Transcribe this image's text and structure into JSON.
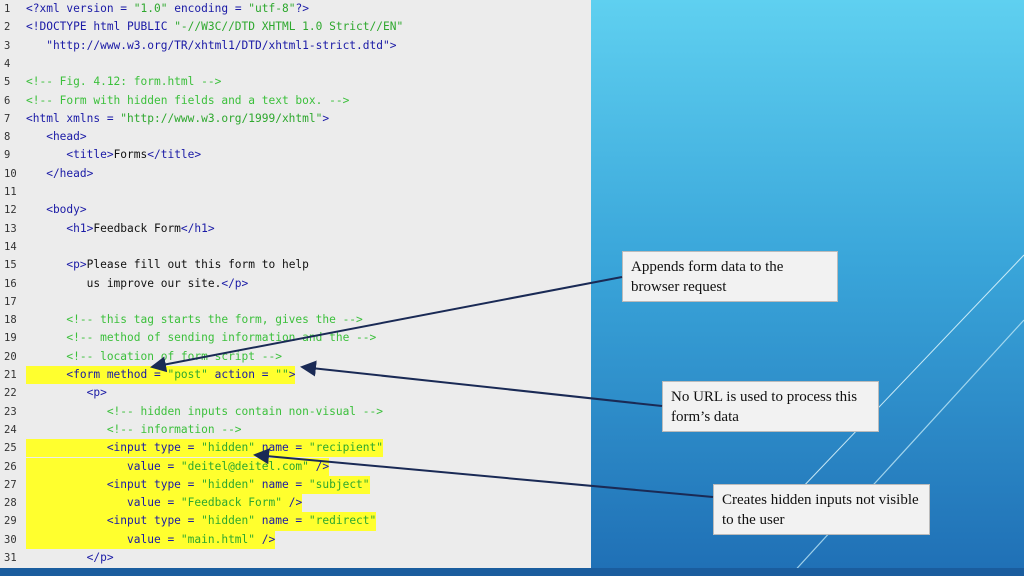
{
  "code_lines": [
    {
      "n": "1",
      "hl": false,
      "parts": [
        [
          "tag",
          "<?xml version = "
        ],
        [
          "str",
          "\"1.0\""
        ],
        [
          "tag",
          " encoding = "
        ],
        [
          "str",
          "\"utf-8\""
        ],
        [
          "tag",
          "?>"
        ]
      ]
    },
    {
      "n": "2",
      "hl": false,
      "parts": [
        [
          "tag",
          "<!DOCTYPE html PUBLIC "
        ],
        [
          "str",
          "\"-//W3C//DTD XHTML 1.0 Strict//EN\""
        ]
      ]
    },
    {
      "n": "3",
      "hl": false,
      "parts": [
        [
          "tag",
          "   \"http://www.w3.org/TR/xhtml1/DTD/xhtml1-strict.dtd\">"
        ]
      ]
    },
    {
      "n": "4",
      "hl": false,
      "parts": []
    },
    {
      "n": "5",
      "hl": false,
      "parts": [
        [
          "cmt",
          "<!-- Fig. 4.12: form.html -->"
        ]
      ]
    },
    {
      "n": "6",
      "hl": false,
      "parts": [
        [
          "cmt",
          "<!-- Form with hidden fields and a text box. -->"
        ]
      ]
    },
    {
      "n": "7",
      "hl": false,
      "parts": [
        [
          "tag",
          "<html xmlns = "
        ],
        [
          "str",
          "\"http://www.w3.org/1999/xhtml\""
        ],
        [
          "tag",
          ">"
        ]
      ]
    },
    {
      "n": "8",
      "hl": false,
      "parts": [
        [
          "tag",
          "   <head>"
        ]
      ]
    },
    {
      "n": "9",
      "hl": false,
      "parts": [
        [
          "tag",
          "      <title>"
        ],
        [
          "txt",
          "Forms"
        ],
        [
          "tag",
          "</title>"
        ]
      ]
    },
    {
      "n": "10",
      "hl": false,
      "parts": [
        [
          "tag",
          "   </head>"
        ]
      ]
    },
    {
      "n": "11",
      "hl": false,
      "parts": []
    },
    {
      "n": "12",
      "hl": false,
      "parts": [
        [
          "tag",
          "   <body>"
        ]
      ]
    },
    {
      "n": "13",
      "hl": false,
      "parts": [
        [
          "tag",
          "      <h1>"
        ],
        [
          "txt",
          "Feedback Form"
        ],
        [
          "tag",
          "</h1>"
        ]
      ]
    },
    {
      "n": "14",
      "hl": false,
      "parts": []
    },
    {
      "n": "15",
      "hl": false,
      "parts": [
        [
          "tag",
          "      <p>"
        ],
        [
          "txt",
          "Please fill out this form to help"
        ]
      ]
    },
    {
      "n": "16",
      "hl": false,
      "parts": [
        [
          "txt",
          "         us improve our site."
        ],
        [
          "tag",
          "</p>"
        ]
      ]
    },
    {
      "n": "17",
      "hl": false,
      "parts": []
    },
    {
      "n": "18",
      "hl": false,
      "parts": [
        [
          "cmt",
          "      <!-- this tag starts the form, gives the -->"
        ]
      ]
    },
    {
      "n": "19",
      "hl": false,
      "parts": [
        [
          "cmt",
          "      <!-- method of sending information and the -->"
        ]
      ]
    },
    {
      "n": "20",
      "hl": false,
      "parts": [
        [
          "cmt",
          "      <!-- location of form script -->"
        ]
      ]
    },
    {
      "n": "21",
      "hl": true,
      "parts": [
        [
          "tag",
          "      <form method = "
        ],
        [
          "str",
          "\"post\""
        ],
        [
          "tag",
          " action = "
        ],
        [
          "str",
          "\"\""
        ],
        [
          "tag",
          ">"
        ]
      ]
    },
    {
      "n": "22",
      "hl": false,
      "parts": [
        [
          "tag",
          "         <p>"
        ]
      ]
    },
    {
      "n": "23",
      "hl": false,
      "parts": [
        [
          "cmt",
          "            <!-- hidden inputs contain non-visual -->"
        ]
      ]
    },
    {
      "n": "24",
      "hl": false,
      "parts": [
        [
          "cmt",
          "            <!-- information -->"
        ]
      ]
    },
    {
      "n": "25",
      "hl": true,
      "parts": [
        [
          "tag",
          "            <input type = "
        ],
        [
          "str",
          "\"hidden\""
        ],
        [
          "tag",
          " name = "
        ],
        [
          "str",
          "\"recipient\""
        ]
      ]
    },
    {
      "n": "26",
      "hl": true,
      "parts": [
        [
          "tag",
          "               value = "
        ],
        [
          "str",
          "\"deitel@deitel.com\""
        ],
        [
          "tag",
          " />"
        ]
      ]
    },
    {
      "n": "27",
      "hl": true,
      "parts": [
        [
          "tag",
          "            <input type = "
        ],
        [
          "str",
          "\"hidden\""
        ],
        [
          "tag",
          " name = "
        ],
        [
          "str",
          "\"subject\""
        ]
      ]
    },
    {
      "n": "28",
      "hl": true,
      "parts": [
        [
          "tag",
          "               value = "
        ],
        [
          "str",
          "\"Feedback Form\""
        ],
        [
          "tag",
          " />"
        ]
      ]
    },
    {
      "n": "29",
      "hl": true,
      "parts": [
        [
          "tag",
          "            <input type = "
        ],
        [
          "str",
          "\"hidden\""
        ],
        [
          "tag",
          " name = "
        ],
        [
          "str",
          "\"redirect\""
        ]
      ]
    },
    {
      "n": "30",
      "hl": true,
      "parts": [
        [
          "tag",
          "               value = "
        ],
        [
          "str",
          "\"main.html\""
        ],
        [
          "tag",
          " />"
        ]
      ]
    },
    {
      "n": "31",
      "hl": false,
      "parts": [
        [
          "tag",
          "         </p>"
        ]
      ]
    }
  ],
  "callouts": {
    "append": "Appends form data to the browser request",
    "no_url": "No URL is used to process this form’s data",
    "hidden": "Creates hidden inputs not visible to the user"
  },
  "colors": {
    "highlight": "#ffff2e",
    "tag": "#1a1aa6",
    "string": "#2ea82e",
    "comment": "#3cc03c",
    "background_top": "#5fd0f0",
    "background_bottom": "#1f6fb5"
  }
}
